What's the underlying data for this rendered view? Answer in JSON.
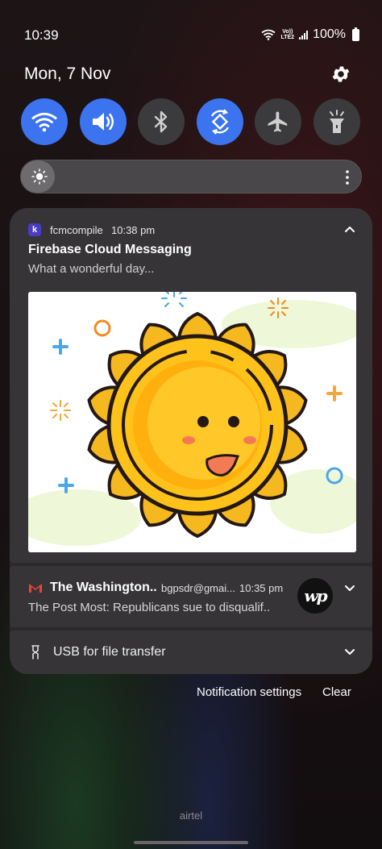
{
  "status_bar": {
    "time": "10:39",
    "volte_top": "Vo))",
    "volte_bottom": "LTE2",
    "battery": "100%"
  },
  "header": {
    "date": "Mon, 7 Nov"
  },
  "quick_settings": {
    "tiles": [
      {
        "icon": "wifi-icon",
        "on": true
      },
      {
        "icon": "sound-icon",
        "on": true
      },
      {
        "icon": "bluetooth-icon",
        "on": false
      },
      {
        "icon": "auto-rotate-icon",
        "on": true
      },
      {
        "icon": "airplane-icon",
        "on": false
      },
      {
        "icon": "flashlight-icon",
        "on": false
      }
    ],
    "brightness_level": 0.04
  },
  "notifications": [
    {
      "app_icon_letter": "k",
      "app_name": "fcmcompile",
      "time": "10:38 pm",
      "title": "Firebase Cloud Messaging",
      "body": "What a wonderful day..."
    },
    {
      "app": "Gmail",
      "sender": "The Washington..",
      "account": "bgpsdr@gmai...",
      "time": "10:35 pm",
      "preview": "The Post Most: Republicans sue to disqualif..",
      "avatar_text": "wp"
    },
    {
      "title": "USB for file transfer"
    }
  ],
  "footer": {
    "notification_settings": "Notification settings",
    "clear": "Clear",
    "carrier": "airtel"
  },
  "colors": {
    "accent": "#3c73ee",
    "panel": "#2b292c",
    "card": "#363437"
  }
}
